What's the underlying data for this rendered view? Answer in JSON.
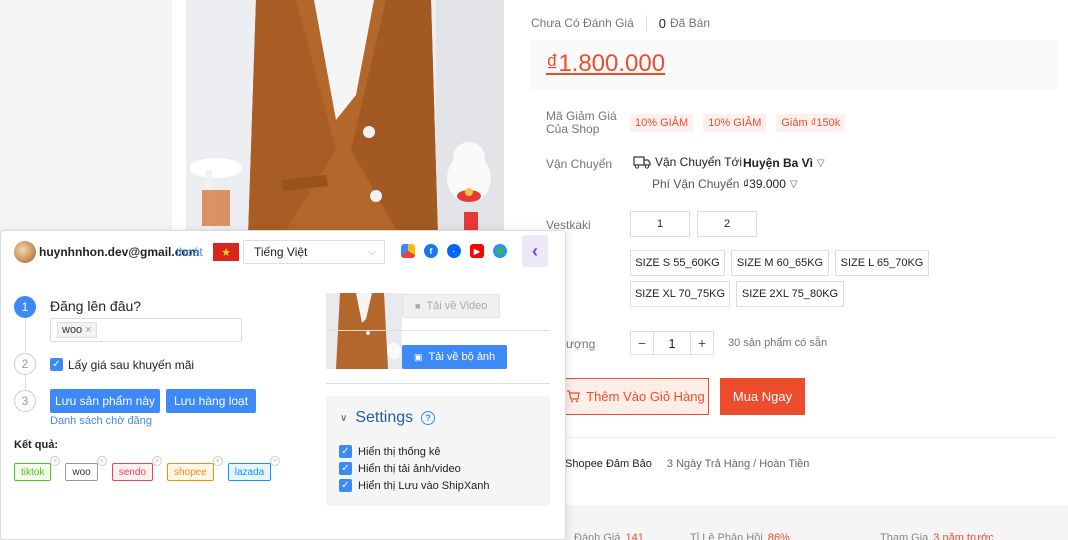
{
  "product": {
    "rating_label": "Chưa Có Đánh Giá",
    "sold_count": "0",
    "sold_label": "Đã Bán",
    "price": "₫1.800.000",
    "voucher_label": "Mã Giảm Giá Của Shop",
    "vouchers": [
      "10% GIẢM",
      "10% GIẢM",
      "Giảm ₫150k"
    ],
    "shipping_label": "Vận Chuyển",
    "ship_to_label": "Vận Chuyển Tới",
    "ship_to_value": "Huyện Ba Vì",
    "ship_fee_label": "Phí Vận Chuyển",
    "ship_fee_value": "₫39.000",
    "variant_label": "Vestkaki",
    "variants": [
      "1",
      "2"
    ],
    "sizes_row1": [
      "SIZE S 55_60KG",
      "SIZE M 60_65KG",
      "SIZE L 65_70KG"
    ],
    "sizes_row2": [
      "SIZE XL 70_75KG",
      "SIZE 2XL 75_80KG"
    ],
    "qty_label": "ượng",
    "qty_value": "1",
    "qty_minus": "−",
    "qty_plus": "+",
    "stock_text": "30 sản phẩm có sẵn",
    "add_cart_label": "Thêm Vào Giỏ Hàng",
    "buy_now_label": "Mua Ngay",
    "guarantee_label": "Shopee Đảm Bảo",
    "guarantee_sub": "3 Ngày Trả Hàng / Hoàn Tiền",
    "stats": [
      {
        "label": "Đánh Giá",
        "value": "141"
      },
      {
        "label": "Tỉ Lệ Phản Hồi",
        "value": "86%"
      },
      {
        "label": "Tham Gia",
        "value": "3 năm trước"
      }
    ]
  },
  "panel": {
    "email": "huynhnhon.dev@gmail.com",
    "logout_label": "thoát",
    "language": "Tiếng Việt",
    "flag_star": "★",
    "step1_num": "1",
    "step1_title": "Đăng lên đâu?",
    "platform_chip": "woo",
    "chip_close": "×",
    "step2_num": "2",
    "discount_checkbox_label": "Lấy giá sau khuyến mãi",
    "step3_num": "3",
    "save_product_label": "Lưu sản phẩm này",
    "save_bulk_label": "Lưu hàng loạt",
    "waitlist_label": "Danh sách chờ đăng",
    "results_label": "Kết quả:",
    "results": [
      {
        "name": "tiktok",
        "color": "#52c41a",
        "bg": "#f6ffed"
      },
      {
        "name": "woo",
        "color": "#999999",
        "bg": "#ffffff"
      },
      {
        "name": "sendo",
        "color": "#e5484d",
        "bg": "#fff1f0"
      },
      {
        "name": "shopee",
        "color": "#fa8c16",
        "bg": "#fff7e6"
      },
      {
        "name": "lazada",
        "color": "#1890ff",
        "bg": "#e6f7ff"
      }
    ],
    "download_video_label": "Tải về Video",
    "download_images_label": "Tải về bộ ảnh",
    "settings_title": "Settings",
    "settings_items": [
      "Hiển thị thống kê",
      "Hiển thị tải ảnh/video",
      "Hiển thị Lưu vào ShipXanh"
    ],
    "check_glyph": "✓",
    "collapse_glyph": "‹"
  }
}
